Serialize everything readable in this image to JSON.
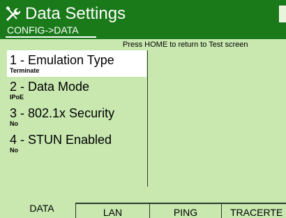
{
  "header": {
    "title": "Data Settings",
    "breadcrumb": "CONFIG->DATA",
    "icon": "wrench-screwdriver-icon"
  },
  "banner": {
    "text": "Press HOME to return to Test screen"
  },
  "menu": {
    "items": [
      {
        "label": "1 - Emulation Type",
        "value": "Terminate",
        "selected": true
      },
      {
        "label": "2 - Data Mode",
        "value": "IPoE",
        "selected": false
      },
      {
        "label": "3 - 802.1x Security",
        "value": "No",
        "selected": false
      },
      {
        "label": "4 - STUN Enabled",
        "value": "No",
        "selected": false
      }
    ]
  },
  "tabs": [
    {
      "label": "DATA",
      "active": true
    },
    {
      "label": "LAN",
      "active": false
    },
    {
      "label": "PING",
      "active": false
    },
    {
      "label": "TRACERTE",
      "active": false
    }
  ],
  "colors": {
    "header_bg": "#1a7a1a",
    "body_bg": "#c8e8b0",
    "selected_bg": "#ffffff"
  }
}
